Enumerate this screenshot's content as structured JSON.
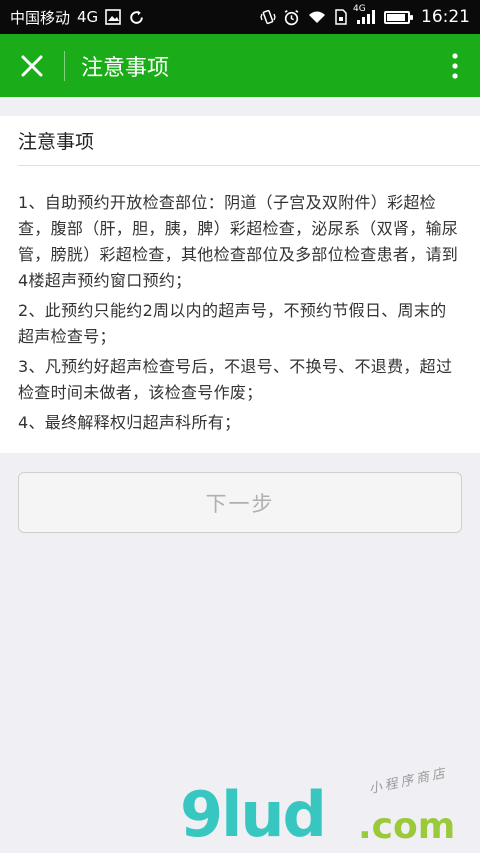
{
  "status_bar": {
    "carrier": "中国移动",
    "network": "4G",
    "network_small": "4G",
    "time": "16:21",
    "battery_level": 0.92
  },
  "nav": {
    "title": "注意事项"
  },
  "card": {
    "header": "注意事项",
    "items": [
      "1、自助预约开放检查部位：阴道（子宫及双附件）彩超检查，腹部（肝，胆，胰，脾）彩超检查，泌尿系（双肾，输尿管，膀胱）彩超检查，其他检查部位及多部位检查患者，请到4楼超声预约窗口预约；",
      "2、此预约只能约2周以内的超声号，不预约节假日、周末的超声检查号；",
      "3、凡预约好超声检查号后，不退号、不换号、不退费，超过检查时间未做者，该检查号作废；",
      "4、最终解释权归超声科所有；"
    ]
  },
  "next_button": {
    "label": "下一步"
  },
  "watermark": {
    "main": "9lud",
    "tld": ".com",
    "caption": "小程序商店"
  },
  "colors": {
    "nav": "#1aad19",
    "background": "#efeff4"
  }
}
